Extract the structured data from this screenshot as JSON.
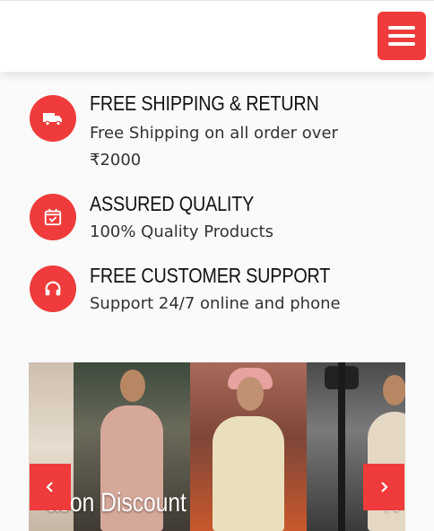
{
  "header": {
    "menu_icon": "hamburger-menu-icon",
    "accent_color": "#ef3b3b"
  },
  "features": [
    {
      "icon": "truck-icon",
      "title": "FREE SHIPPING & RETURN",
      "description": "Free Shipping on all order over ₹2000"
    },
    {
      "icon": "calendar-check-icon",
      "title": "ASSURED QUALITY",
      "description": "100% Quality Products"
    },
    {
      "icon": "headphones-icon",
      "title": "FREE CUSTOMER SUPPORT",
      "description": "Support 24/7 online and phone"
    }
  ],
  "slider": {
    "caption_left": "ason Discount",
    "caption_right": "N",
    "prev_icon": "chevron-left-icon",
    "next_icon": "chevron-right-icon"
  }
}
